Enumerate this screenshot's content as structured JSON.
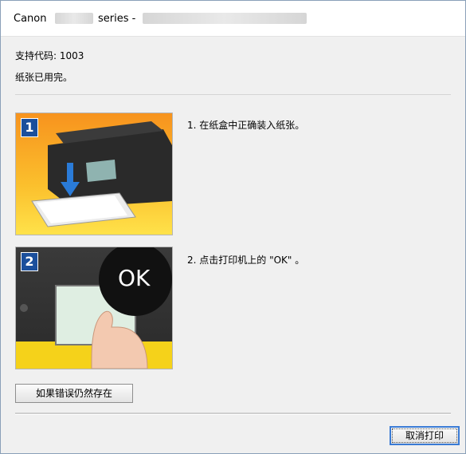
{
  "window": {
    "title_brand": "Canon",
    "title_series": "series -"
  },
  "content": {
    "support_code": "支持代码: 1003",
    "message": "纸张已用完。"
  },
  "steps": [
    {
      "number": "1",
      "text": "1.   在纸盒中正确装入纸张。"
    },
    {
      "number": "2",
      "text": "2.   点击打印机上的 \"OK\" 。",
      "image_badge": "OK"
    }
  ],
  "buttons": {
    "persist_label": "如果错误仍然存在",
    "cancel_label": "取消打印"
  }
}
